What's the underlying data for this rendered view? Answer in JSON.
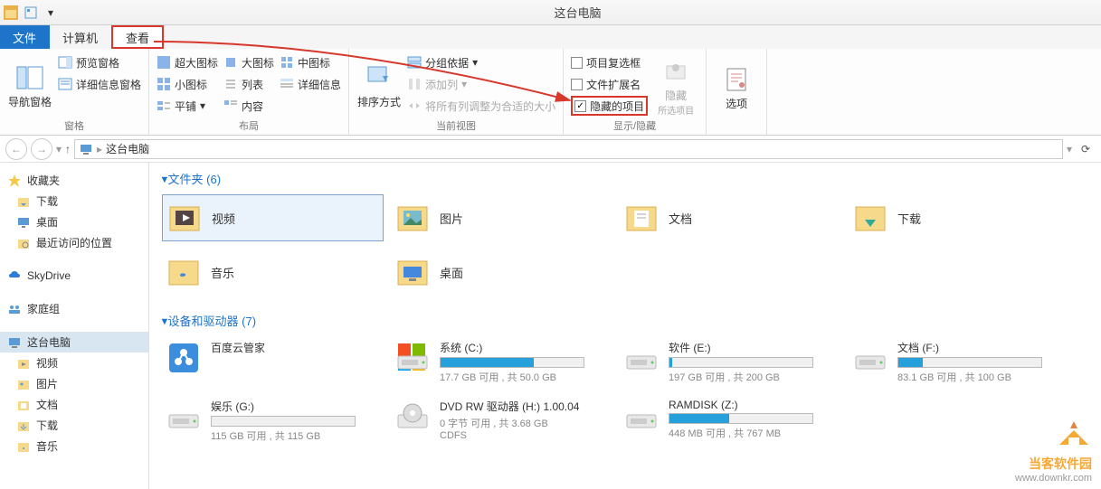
{
  "window": {
    "title": "这台电脑"
  },
  "tabs": {
    "file": "文件",
    "computer": "计算机",
    "view": "查看"
  },
  "ribbon": {
    "panes": {
      "nav": "导航窗格",
      "preview": "预览窗格",
      "details": "详细信息窗格",
      "title": "窗格"
    },
    "layout": {
      "extra_large": "超大图标",
      "large": "大图标",
      "medium": "中图标",
      "small": "小图标",
      "list": "列表",
      "details": "详细信息",
      "tiles": "平铺",
      "content": "内容",
      "title": "布局"
    },
    "view": {
      "sort": "排序方式",
      "group": "分组依据",
      "addcol": "添加列",
      "autosize": "将所有列调整为合适的大小",
      "title": "当前视图"
    },
    "showhide": {
      "checkboxes": "项目复选框",
      "extensions": "文件扩展名",
      "hidden": "隐藏的项目",
      "hide": "隐藏",
      "hide_sub": "所选项目",
      "title": "显示/隐藏"
    },
    "options": {
      "label": "选项"
    }
  },
  "addressbar": {
    "location": "这台电脑"
  },
  "sidebar": {
    "favorites": {
      "label": "收藏夹",
      "items": [
        "下载",
        "桌面",
        "最近访问的位置"
      ]
    },
    "skydrive": "SkyDrive",
    "homegroup": "家庭组",
    "thispc": {
      "label": "这台电脑",
      "items": [
        "视频",
        "图片",
        "文档",
        "下载",
        "音乐"
      ]
    }
  },
  "content": {
    "folders_title": "文件夹 (6)",
    "folders": [
      "视频",
      "图片",
      "文档",
      "下载",
      "音乐",
      "桌面"
    ],
    "devices_title": "设备和驱动器 (7)",
    "devices": [
      {
        "name": "百度云管家",
        "stats": "",
        "fill": 0,
        "nobar": true
      },
      {
        "name": "系统 (C:)",
        "stats": "17.7 GB 可用 , 共 50.0 GB",
        "fill": 65
      },
      {
        "name": "软件 (E:)",
        "stats": "197 GB 可用 , 共 200 GB",
        "fill": 2
      },
      {
        "name": "文档 (F:)",
        "stats": "83.1 GB 可用 , 共 100 GB",
        "fill": 17
      },
      {
        "name": "娱乐 (G:)",
        "stats": "115 GB 可用 , 共 115 GB",
        "fill": 0
      },
      {
        "name": "DVD RW 驱动器 (H:) 1.00.04",
        "stats": "0 字节 可用 , 共 3.68 GB",
        "extra": "CDFS",
        "fill": 0,
        "nobar": true
      },
      {
        "name": "RAMDISK (Z:)",
        "stats": "448 MB 可用 , 共 767 MB",
        "fill": 42
      }
    ]
  },
  "watermark": {
    "brand": "当客软件园",
    "url": "www.downkr.com"
  }
}
